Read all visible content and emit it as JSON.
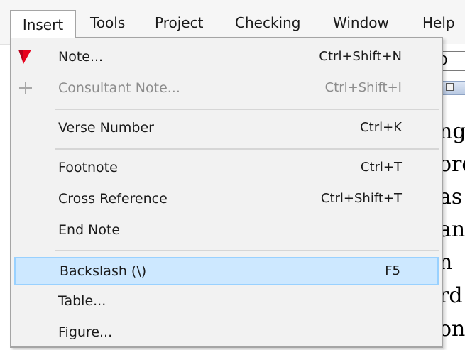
{
  "menubar": {
    "items": [
      {
        "label": "Insert",
        "open": true
      },
      {
        "label": "Tools"
      },
      {
        "label": "Project"
      },
      {
        "label": "Checking"
      },
      {
        "label": "Window"
      },
      {
        "label": "Help"
      }
    ]
  },
  "background_doc": {
    "field_value": "0",
    "lines": [
      "ng",
      "ord",
      "as",
      "an",
      "n",
      "rd",
      "on"
    ]
  },
  "insert_menu": {
    "items": [
      {
        "label": "Note...",
        "shortcut": "Ctrl+Shift+N",
        "icon": "red-flag-icon",
        "enabled": true
      },
      {
        "label": "Consultant Note...",
        "shortcut": "Ctrl+Shift+I",
        "icon": "plus-icon",
        "enabled": false
      },
      {
        "label": "Verse Number",
        "shortcut": "Ctrl+K",
        "enabled": true
      },
      {
        "label": "Footnote",
        "shortcut": "Ctrl+T",
        "enabled": true
      },
      {
        "label": "Cross Reference",
        "shortcut": "Ctrl+Shift+T",
        "enabled": true
      },
      {
        "label": "End Note",
        "shortcut": "",
        "enabled": true
      },
      {
        "label": "Backslash (\\)",
        "shortcut": "F5",
        "enabled": true,
        "highlighted": true
      },
      {
        "label": "Table...",
        "shortcut": "",
        "enabled": true
      },
      {
        "label": "Figure...",
        "shortcut": "",
        "enabled": true
      }
    ]
  },
  "colors": {
    "highlight_fill": "#cde8ff",
    "highlight_border": "#99d1ff",
    "flag_red": "#e8001c",
    "disabled_text": "#8c8c8c"
  }
}
